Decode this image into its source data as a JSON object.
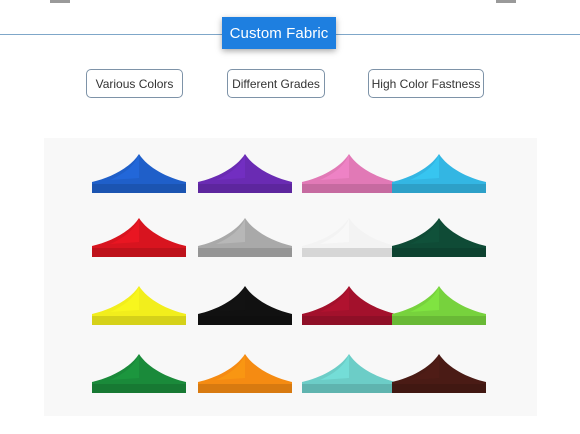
{
  "title": "Custom Fabric",
  "tags": [
    "Various Colors",
    "Different Grades",
    "High Color Fastness"
  ],
  "swatches": [
    {
      "name": "blue",
      "color": "#1f5fc9"
    },
    {
      "name": "purple",
      "color": "#6a2bb3"
    },
    {
      "name": "pink",
      "color": "#e179b6"
    },
    {
      "name": "sky-blue",
      "color": "#33b6e3"
    },
    {
      "name": "red",
      "color": "#d8141f"
    },
    {
      "name": "gray",
      "color": "#a9a9a9"
    },
    {
      "name": "white",
      "color": "#f3f3f3"
    },
    {
      "name": "dark-green",
      "color": "#0f4b36"
    },
    {
      "name": "yellow",
      "color": "#f2ee1c"
    },
    {
      "name": "black",
      "color": "#111111"
    },
    {
      "name": "burgundy",
      "color": "#a3112c"
    },
    {
      "name": "lime-green",
      "color": "#77d23d"
    },
    {
      "name": "green",
      "color": "#1a8a3a"
    },
    {
      "name": "orange",
      "color": "#f58b12"
    },
    {
      "name": "turquoise",
      "color": "#6ccdc7"
    },
    {
      "name": "brown",
      "color": "#4a1b15"
    }
  ]
}
